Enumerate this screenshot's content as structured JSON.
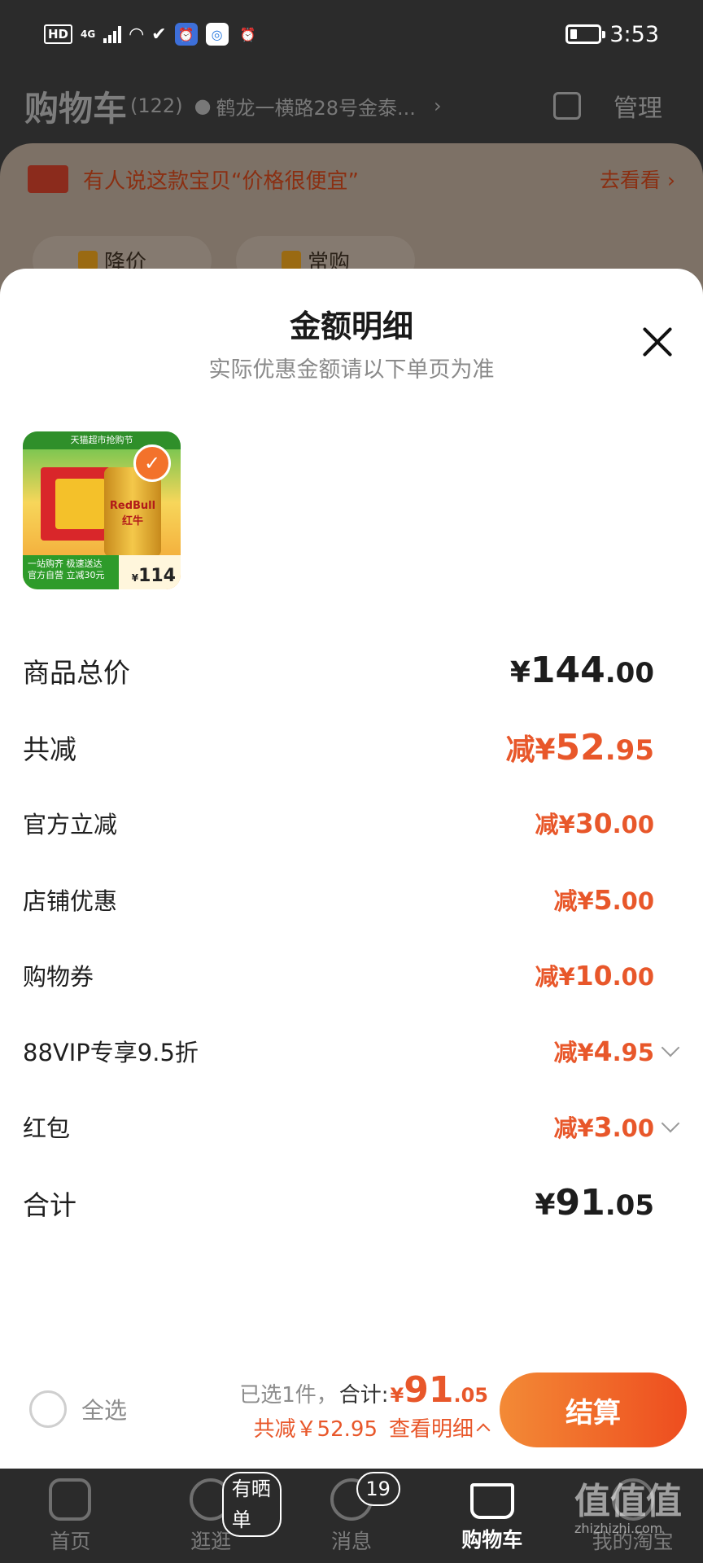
{
  "status_bar": {
    "hd": "HD",
    "network": "4G",
    "time": "3:53",
    "apps": [
      "wifi-icon",
      "app-icon-1",
      "app-icon-2",
      "app-icon-3",
      "app-icon-4"
    ]
  },
  "cart_header": {
    "title": "购物车",
    "count": "(122)",
    "address": "鹤龙一横路28号金泰...",
    "manage": "管理"
  },
  "promo": {
    "text": "有人说这款宝贝“价格很便宜”",
    "link": "去看看",
    "text_color": "#8a2f12"
  },
  "bg_tabs": [
    "降价",
    "常购"
  ],
  "sheet": {
    "title": "金额明细",
    "subtitle": "实际优惠金额请以下单页为准",
    "product": {
      "price": "114",
      "currency": "¥",
      "banner": "天猫超市抢购节",
      "can_text": "RedBull 红牛",
      "footer_line1": "一站购齐 极速送达",
      "footer_line2": "官方自营 立减30元"
    },
    "rows": {
      "total": {
        "label": "商品总价",
        "sym": "¥",
        "int": "144",
        "dec": ".00"
      },
      "saved": {
        "label": "共减",
        "sym": "减¥",
        "int": "52",
        "dec": ".95"
      },
      "official": {
        "label": "官方立减",
        "sym": "减¥",
        "int": "30",
        "dec": ".00"
      },
      "store": {
        "label": "店铺优惠",
        "sym": "减¥",
        "int": "5",
        "dec": ".00"
      },
      "coupon": {
        "label": "购物券",
        "sym": "减¥",
        "int": "10",
        "dec": ".00"
      },
      "vip": {
        "label": "88VIP专享9.5折",
        "sym": "减¥",
        "int": "4",
        "dec": ".95"
      },
      "redpacket": {
        "label": "红包",
        "sym": "减¥",
        "int": "3",
        "dec": ".00"
      },
      "sum": {
        "label": "合计",
        "sym": "¥",
        "int": "91",
        "dec": ".05"
      }
    }
  },
  "checkout": {
    "select_all": "全选",
    "selected": "已选1件，",
    "sum_label": "合计:",
    "sum_sym": "¥",
    "sum_int": "91",
    "sum_dec": ".05",
    "saved_text": "共减￥52.95",
    "detail_link": "查看明细",
    "button": "结算",
    "accent": "#e8572a"
  },
  "bottom_nav": {
    "items": [
      {
        "label": "首页"
      },
      {
        "label": "逛逛",
        "badge": "有晒单"
      },
      {
        "label": "消息",
        "badge": "19"
      },
      {
        "label": "购物车"
      },
      {
        "label": "我的淘宝"
      }
    ]
  },
  "watermark": {
    "text": "值值值",
    "sub": "zhizhizhi.com"
  }
}
